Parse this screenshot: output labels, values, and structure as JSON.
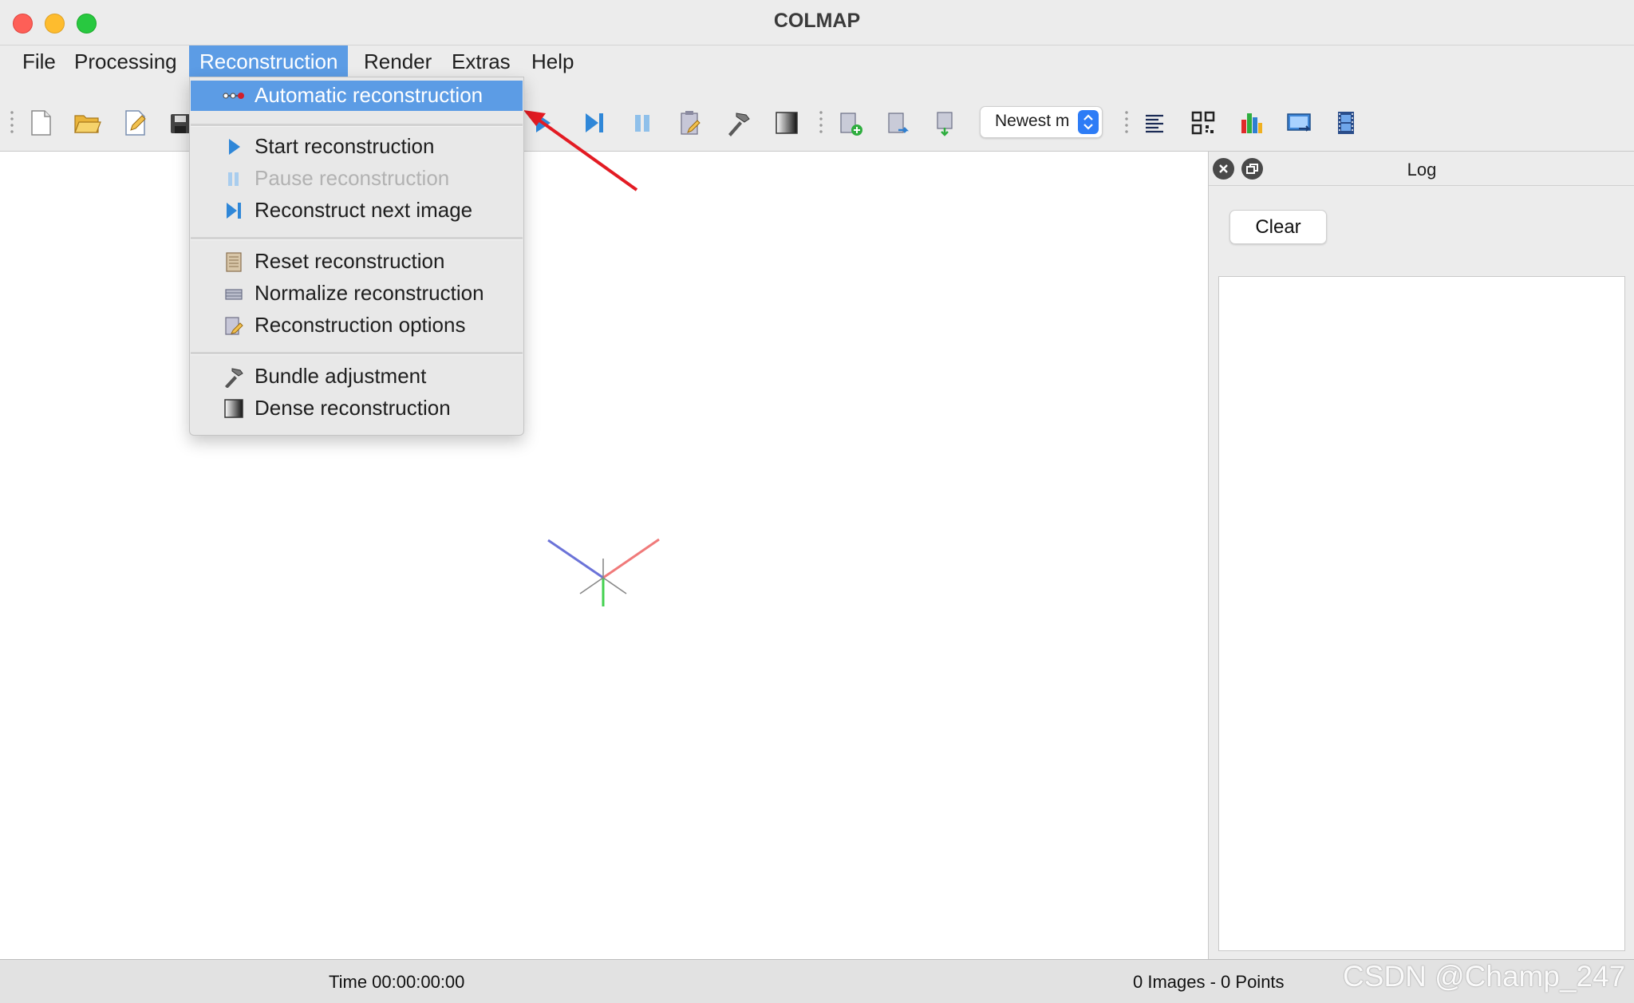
{
  "window": {
    "title": "COLMAP"
  },
  "menubar": {
    "items": [
      "File",
      "Processing",
      "Reconstruction",
      "Render",
      "Extras",
      "Help"
    ],
    "active": "Reconstruction"
  },
  "toolbar": {
    "sort_select": {
      "value": "Newest m"
    }
  },
  "reconstruction_menu": {
    "groups": [
      [
        {
          "label": "Automatic reconstruction",
          "icon": "automatic-reconstruction-icon",
          "state": "highlighted"
        }
      ],
      [
        {
          "label": "Start reconstruction",
          "icon": "play-icon",
          "state": "enabled"
        },
        {
          "label": "Pause reconstruction",
          "icon": "pause-icon",
          "state": "disabled"
        },
        {
          "label": "Reconstruct next image",
          "icon": "step-forward-icon",
          "state": "enabled"
        }
      ],
      [
        {
          "label": "Reset reconstruction",
          "icon": "reset-icon",
          "state": "enabled"
        },
        {
          "label": "Normalize reconstruction",
          "icon": "normalize-icon",
          "state": "enabled"
        },
        {
          "label": "Reconstruction options",
          "icon": "options-icon",
          "state": "enabled"
        }
      ],
      [
        {
          "label": "Bundle adjustment",
          "icon": "hammer-icon",
          "state": "enabled"
        },
        {
          "label": "Dense reconstruction",
          "icon": "dense-icon",
          "state": "enabled"
        }
      ]
    ]
  },
  "log_panel": {
    "title": "Log",
    "clear_label": "Clear",
    "content": ""
  },
  "statusbar": {
    "time": "Time 00:00:00:00",
    "counts": "0 Images - 0 Points"
  },
  "watermark": "CSDN @Champ_247",
  "colors": {
    "accent": "#5c9ce5",
    "annotation_arrow": "#e31b23",
    "axis_x": "#f07a7a",
    "axis_y": "#43d14f",
    "axis_z": "#6b73d8"
  }
}
